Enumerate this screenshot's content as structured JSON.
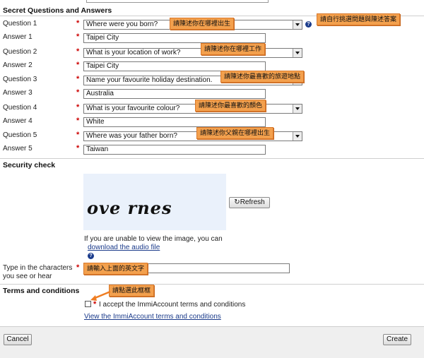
{
  "section_titles": {
    "secret": "Secret Questions and Answers",
    "security": "Security check",
    "terms": "Terms and conditions"
  },
  "questions": [
    {
      "q_label": "Question 1",
      "q_value": "Where were you born?",
      "a_label": "Answer 1",
      "a_value": "Taipei City",
      "callout": "請陳述你在哪裡出生"
    },
    {
      "q_label": "Question 2",
      "q_value": "What is your location of work?",
      "a_label": "Answer 2",
      "a_value": "Taipei City",
      "callout": "請陳述你在哪裡工作"
    },
    {
      "q_label": "Question 3",
      "q_value": "Name your favourite holiday destination.",
      "a_label": "Answer 3",
      "a_value": "Australia",
      "callout": "請陳述你最喜歡的旅遊地點"
    },
    {
      "q_label": "Question 4",
      "q_value": "What is your favourite colour?",
      "a_label": "Answer 4",
      "a_value": "White",
      "callout": "請陳述你最喜歡的顏色"
    },
    {
      "q_label": "Question 5",
      "q_value": "Where was your father born?",
      "a_label": "Answer 5",
      "a_value": "Taiwan",
      "callout": "請陳述你父親在哪裡出生"
    }
  ],
  "callout_top": "請自行挑選問題與陳述答案",
  "required_mark": "*",
  "help_glyph": "?",
  "captcha": {
    "text": "ove rnes",
    "refresh_label": "Refresh",
    "refresh_icon": "refresh-icon",
    "unable_text": "If you are unable to view the image, you can",
    "audio_link": "download the audio file",
    "type_label_1": "Type in the characters",
    "type_label_2": "you see or hear",
    "type_value": "",
    "callout": "請輸入上面的英文字"
  },
  "terms": {
    "callout": "請點選此框框",
    "accept_text": "I accept the ImmiAccount terms and conditions",
    "view_link": "View the ImmiAccount terms and conditions"
  },
  "buttons": {
    "cancel": "Cancel",
    "create": "Create"
  },
  "colors": {
    "callout_bg": "#f3a04d",
    "required": "#cc0000",
    "link": "#1a3a8a"
  }
}
